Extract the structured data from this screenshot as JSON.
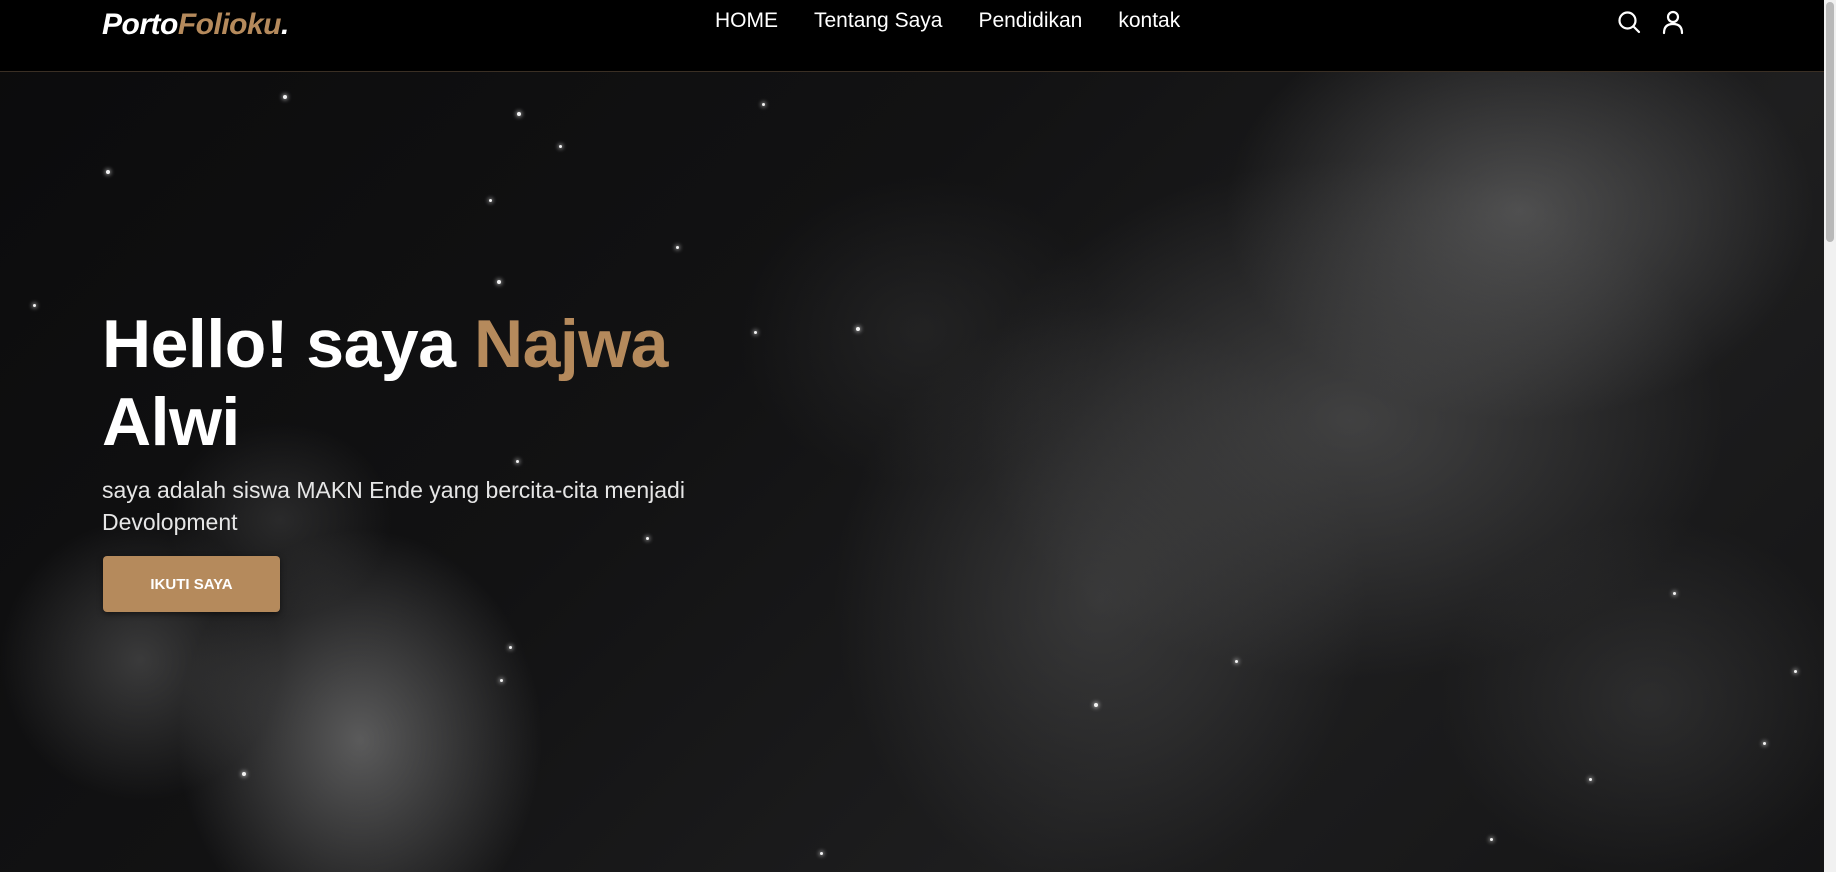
{
  "brand": {
    "logo_part1": "Porto",
    "logo_part2": "Folioku",
    "logo_dot": "."
  },
  "nav": {
    "items": [
      {
        "label": "HOME"
      },
      {
        "label": "Tentang Saya"
      },
      {
        "label": "Pendidikan"
      },
      {
        "label": "kontak"
      }
    ]
  },
  "header_icons": {
    "search": "search-icon",
    "user": "user-icon"
  },
  "hero": {
    "title_prefix": "Hello! saya",
    "title_name": "Najwa",
    "title_last": "Alwi",
    "subtitle": "saya adalah siswa MAKN Ende yang bercita-cita menjadi Devolopment",
    "button_label": "IKUTI SAYA"
  },
  "colors": {
    "accent": "#b58a5c",
    "background": "#000000",
    "text": "#ffffff"
  }
}
